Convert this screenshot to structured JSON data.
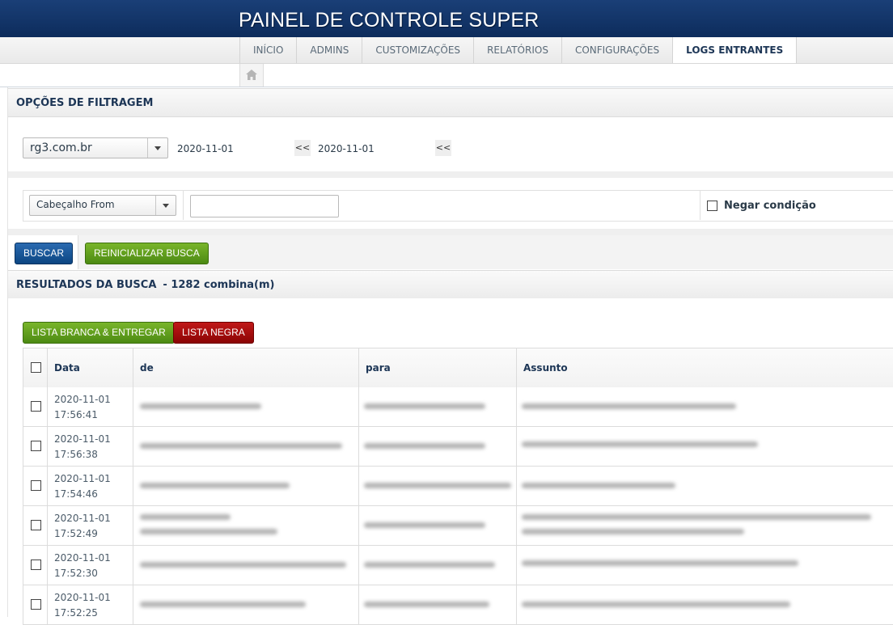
{
  "header": {
    "title": "PAINEL DE CONTROLE SUPER"
  },
  "nav": {
    "tabs": [
      {
        "label": "INÍCIO",
        "active": false
      },
      {
        "label": "ADMINS",
        "active": false
      },
      {
        "label": "CUSTOMIZAÇÕES",
        "active": false
      },
      {
        "label": "RELATÓRIOS",
        "active": false
      },
      {
        "label": "CONFIGURAÇÕES",
        "active": false
      },
      {
        "label": "LOGS ENTRANTES",
        "active": true
      }
    ],
    "home_icon": "home-icon"
  },
  "filter": {
    "title": "OPÇÕES DE FILTRAGEM",
    "domain_value": "rg3.com.br",
    "date_from": "2020-11-01",
    "date_to": "2020-11-01",
    "cal_button": "<<",
    "condition_field": "Cabeçalho From",
    "condition_value": "",
    "negate_label": "Negar condição",
    "negate_checked": false
  },
  "actions": {
    "search": "BUSCAR",
    "reset": "REINICIALIZAR BUSCA"
  },
  "results": {
    "title": "RESULTADOS DA BUSCA",
    "count_text": "- 1282 combina(m)",
    "whitelist_button": "LISTA BRANCA & ENTREGAR",
    "blacklist_button": "LISTA NEGRA",
    "columns": [
      "Data",
      "de",
      "para",
      "Assunto"
    ],
    "rows": [
      {
        "date": "2020-11-01",
        "time": "17:56:41"
      },
      {
        "date": "2020-11-01",
        "time": "17:56:38"
      },
      {
        "date": "2020-11-01",
        "time": "17:54:46"
      },
      {
        "date": "2020-11-01",
        "time": "17:52:49"
      },
      {
        "date": "2020-11-01",
        "time": "17:52:30"
      },
      {
        "date": "2020-11-01",
        "time": "17:52:25"
      }
    ]
  },
  "colors": {
    "header_bg": "#0d2c5c",
    "accent_text": "#1d3656",
    "btn_blue": "#0c4682",
    "btn_green": "#4c8a13",
    "btn_red": "#8b0404"
  }
}
